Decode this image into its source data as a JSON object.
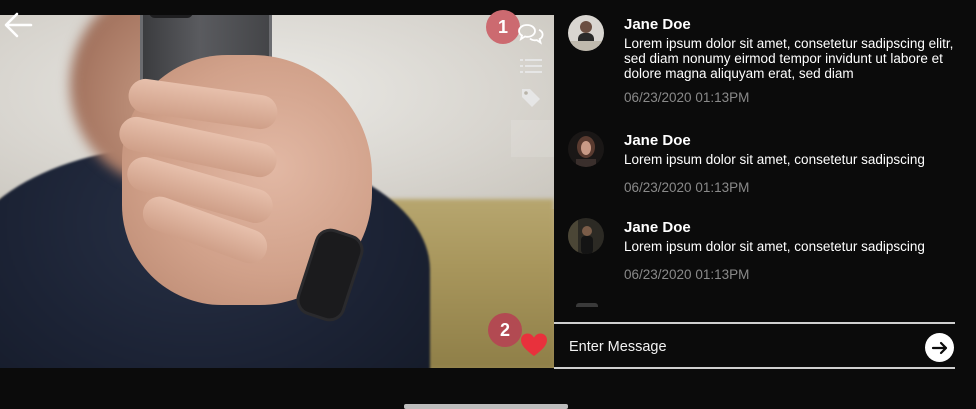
{
  "overlay": {
    "markers": [
      "1",
      "2"
    ]
  },
  "icons": {
    "back": "arrow-left-icon",
    "comments": "comments-icon",
    "list": "list-icon",
    "tag": "tag-icon",
    "like": "heart-icon",
    "send": "arrow-right-icon"
  },
  "colors": {
    "background": "#0b0b0b",
    "marker": "#cc6a70",
    "heart": "#e8313c",
    "time": "#8a8a8a"
  },
  "comments": [
    {
      "author": "Jane Doe",
      "text": "Lorem ipsum dolor sit amet, consetetur sadipscing elitr, sed diam nonumy eirmod tempor invidunt ut labore et dolore magna aliquyam erat, sed diam",
      "time": "06/23/2020 01:13PM"
    },
    {
      "author": "Jane Doe",
      "text": "Lorem ipsum dolor sit amet, consetetur sadipscing",
      "time": "06/23/2020 01:13PM"
    },
    {
      "author": "Jane Doe",
      "text": "Lorem ipsum dolor sit amet, consetetur sadipscing",
      "time": "06/23/2020 01:13PM"
    }
  ],
  "composer": {
    "placeholder": "Enter Message"
  }
}
